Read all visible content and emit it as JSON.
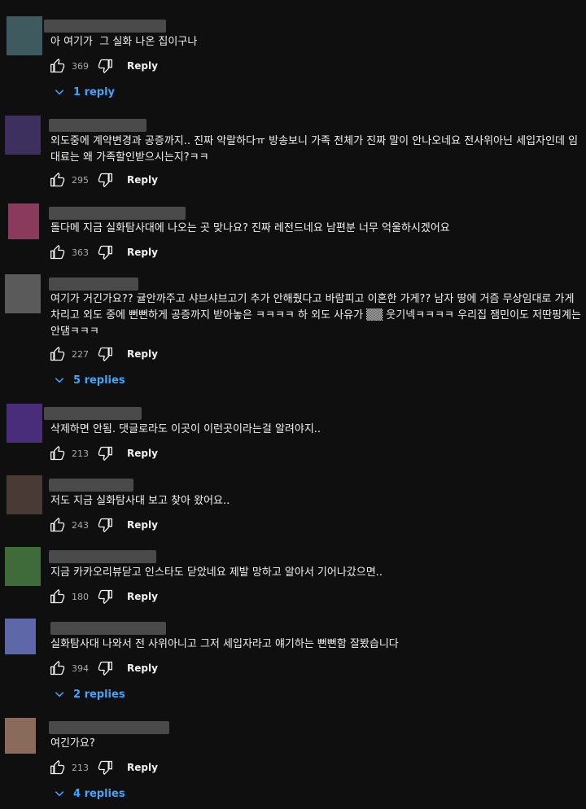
{
  "labels": {
    "reply": "Reply"
  },
  "comments": [
    {
      "text": "아 여기가  그 실화 나온 집이구나",
      "likes": "369",
      "replies": "1 reply",
      "avatar": "#3e5a5e"
    },
    {
      "text": "외도중에 계약변경과 공증까지.. 진짜 악랄하다ㅠ 방송보니 가족 전체가 진짜 말이 안나오네요 전사위아닌 세입자인데 임대료는 왜 가족할인받으시는지?ㅋㅋ",
      "likes": "295",
      "replies": "",
      "avatar": "#3d2f5e"
    },
    {
      "text": "돌다메 지금 실화탐사대에 나오는 곳 맞나요? 진짜 레전드네요 남편분 너무 억울하시겠어요",
      "likes": "363",
      "replies": "",
      "avatar": "#8a3a5a"
    },
    {
      "text": "여기가 거긴가요?? 귤안까주고 샤브샤브고기 추가 안해줬다고 바람피고 이혼한 가게?? 남자 땅에 거즘 무상임대로 가게차리고 외도 중에 뻔뻔하게 공증까지 받아놓은 ㅋㅋㅋㅋ 하 외도 사유가 ▒▒ 웃기넥ㅋㅋㅋㅋ 우리집 잼민이도 저딴핑계는 안댐ㅋㅋㅋ",
      "likes": "227",
      "replies": "5 replies",
      "avatar": "#5a5a5a"
    },
    {
      "text": "삭제하면 안됨. 댓글로라도 이곳이 이런곳이라는걸 알려야지..",
      "likes": "213",
      "replies": "",
      "avatar": "#4a2d7a"
    },
    {
      "text": "저도 지금 실화탐사대 보고 찾아 왔어요..",
      "likes": "243",
      "replies": "",
      "avatar": "#4a3a36"
    },
    {
      "text": "지금 카카오리뷰닫고 인스타도 닫았네요 제발 망하고 알아서 기어나갔으면..",
      "likes": "180",
      "replies": "",
      "avatar": "#3f6a3a"
    },
    {
      "text": "실화탐사대 나와서 전 사위아니고 그저 세입자라고 얘기하는 뻔뻔함 잘봤습니다",
      "likes": "394",
      "replies": "2 replies",
      "avatar": "#5e68a8"
    },
    {
      "text": "여긴가요?",
      "likes": "213",
      "replies": "4 replies",
      "avatar": "#8a6a5a"
    }
  ]
}
